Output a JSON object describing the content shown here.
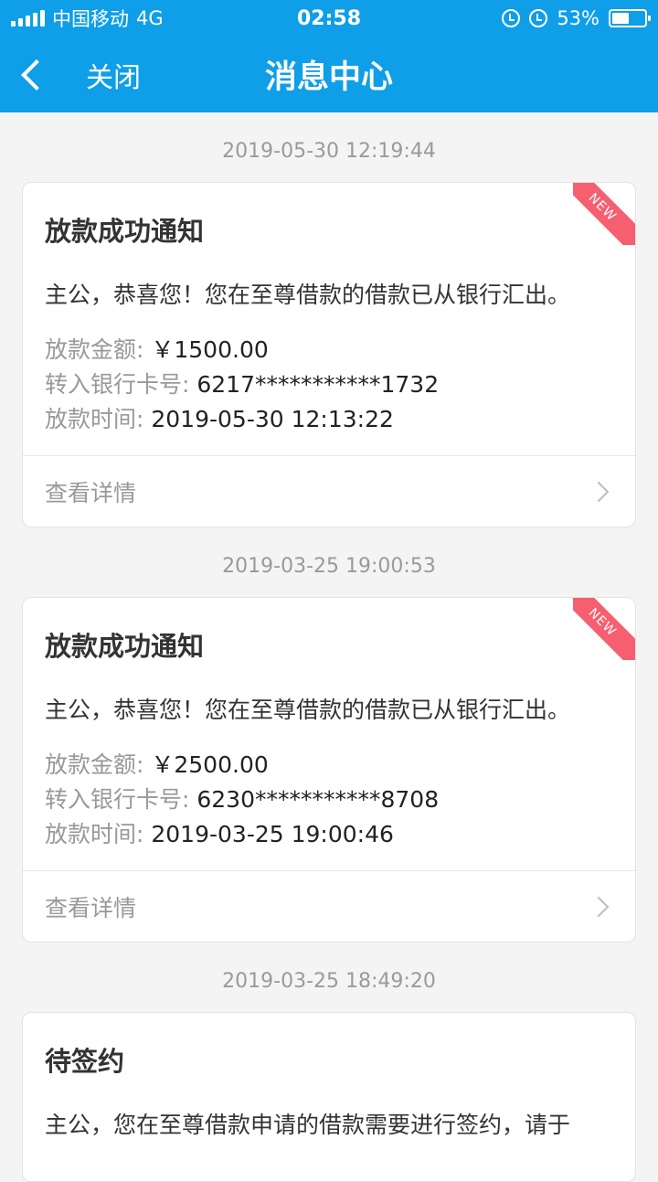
{
  "status_bar": {
    "carrier": "中国移动",
    "network": "4G",
    "time": "02:58",
    "battery_percent": "53%",
    "battery_level": 0.53
  },
  "nav": {
    "back_label": "关闭",
    "title": "消息中心"
  },
  "messages": [
    {
      "timestamp": "2019-05-30 12:19:44",
      "badge": "NEW",
      "title": "放款成功通知",
      "text": "主公，恭喜您！您在至尊借款的借款已从银行汇出。",
      "details": [
        {
          "label": "放款金额: ",
          "value": "￥1500.00"
        },
        {
          "label": "转入银行卡号: ",
          "value": "6217***********1732"
        },
        {
          "label": "放款时间: ",
          "value": "2019-05-30 12:13:22"
        }
      ],
      "footer": "查看详情"
    },
    {
      "timestamp": "2019-03-25 19:00:53",
      "badge": "NEW",
      "title": "放款成功通知",
      "text": "主公，恭喜您！您在至尊借款的借款已从银行汇出。",
      "details": [
        {
          "label": "放款金额: ",
          "value": "￥2500.00"
        },
        {
          "label": "转入银行卡号: ",
          "value": "6230***********8708"
        },
        {
          "label": "放款时间: ",
          "value": "2019-03-25 19:00:46"
        }
      ],
      "footer": "查看详情"
    },
    {
      "timestamp": "2019-03-25 18:49:20",
      "title": "待签约",
      "text": "主公，您在至尊借款申请的借款需要进行签约，请于"
    }
  ]
}
